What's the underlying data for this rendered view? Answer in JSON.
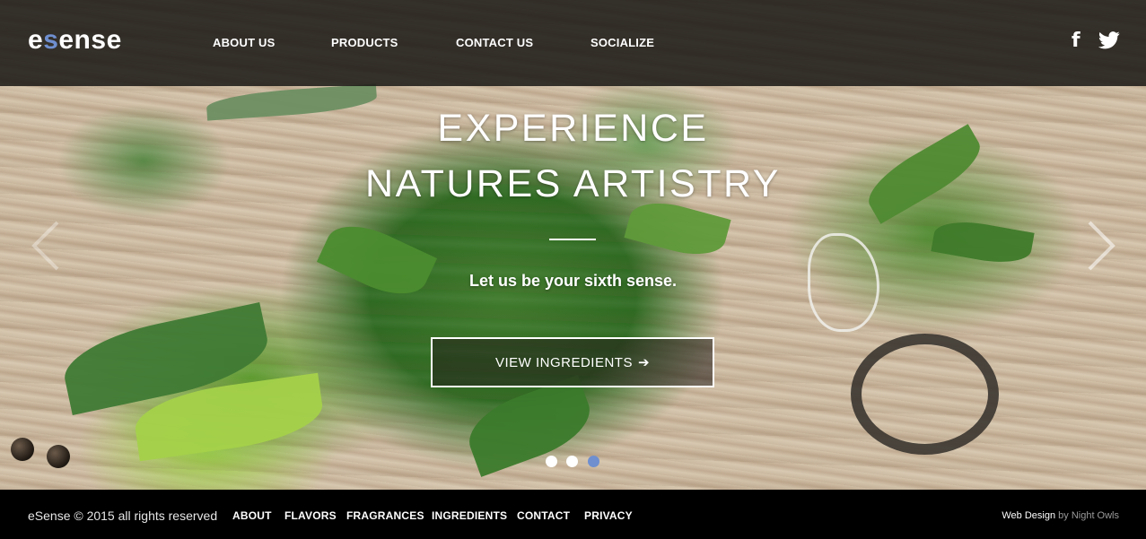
{
  "header": {
    "logo": {
      "prefix": "e",
      "accent": "s",
      "suffix": "ense"
    },
    "nav": [
      "ABOUT US",
      "PRODUCTS",
      "CONTACT US",
      "SOCIALIZE"
    ],
    "social": {
      "facebook_icon": "facebook-icon",
      "twitter_icon": "twitter-icon",
      "facebook_glyph": "f"
    }
  },
  "hero": {
    "headline_line1": "EXPERIENCE",
    "headline_line2": "NATURES ARTISTRY",
    "tagline": "Let us be your sixth sense.",
    "cta_label": "VIEW INGREDIENTS",
    "cta_arrow": "➔",
    "slides": {
      "count": 3,
      "active_index": 2
    }
  },
  "footer": {
    "copyright": "eSense © 2015 all rights reserved",
    "links": [
      "ABOUT",
      "FLAVORS",
      "FRAGRANCES",
      "INGREDIENTS",
      "CONTACT",
      "PRIVACY"
    ],
    "credit_label": "Web Design",
    "credit_by": "by Night Owls"
  },
  "colors": {
    "accent": "#6f8fcf",
    "header_bg": "#1e1b18",
    "footer_bg": "#000000",
    "text": "#ffffff"
  }
}
